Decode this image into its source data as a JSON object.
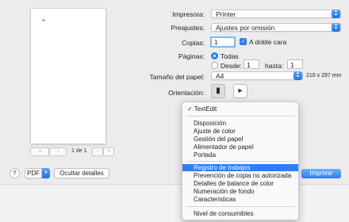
{
  "preview": {
    "page_label": "1 de 1",
    "first_label": "«",
    "prev_label": "‹",
    "next_label": "›",
    "last_label": "»"
  },
  "form": {
    "printer_label": "Impresora:",
    "printer_value": "Printer",
    "presets_label": "Preajustes:",
    "presets_value": "Ajustes por omisión",
    "copies_label": "Copias:",
    "copies_value": "1",
    "duplex_label": "A doble cara",
    "pages_label": "Páginas:",
    "pages_all_label": "Todas",
    "pages_from_label": "Desde:",
    "pages_from_value": "1",
    "pages_to_label": "hasta:",
    "pages_to_value": "1",
    "paper_label": "Tamaño del papel:",
    "paper_value": "A4",
    "paper_dims": "210 x 297 mm",
    "orientation_label": "Orientación:"
  },
  "menu": {
    "checked_item": "TextEdit",
    "group1": [
      "Disposición",
      "Ajuste de color",
      "Gestión del papel",
      "Alimentador de papel",
      "Portada"
    ],
    "group2": [
      "Registro de trabajos",
      "Prevención de copia no autorizada",
      "Detalles de balance de color",
      "Numeración de fondo",
      "Características"
    ],
    "group3": [
      "Nivel de consumibles"
    ],
    "highlighted": "Registro de trabajos"
  },
  "bottom": {
    "help_label": "?",
    "pdf_label": "PDF",
    "hide_details_label": "Ocultar detalles",
    "print_label": "Imprimir"
  },
  "colors": {
    "accent": "#2f7df6",
    "background": "#ececec"
  }
}
